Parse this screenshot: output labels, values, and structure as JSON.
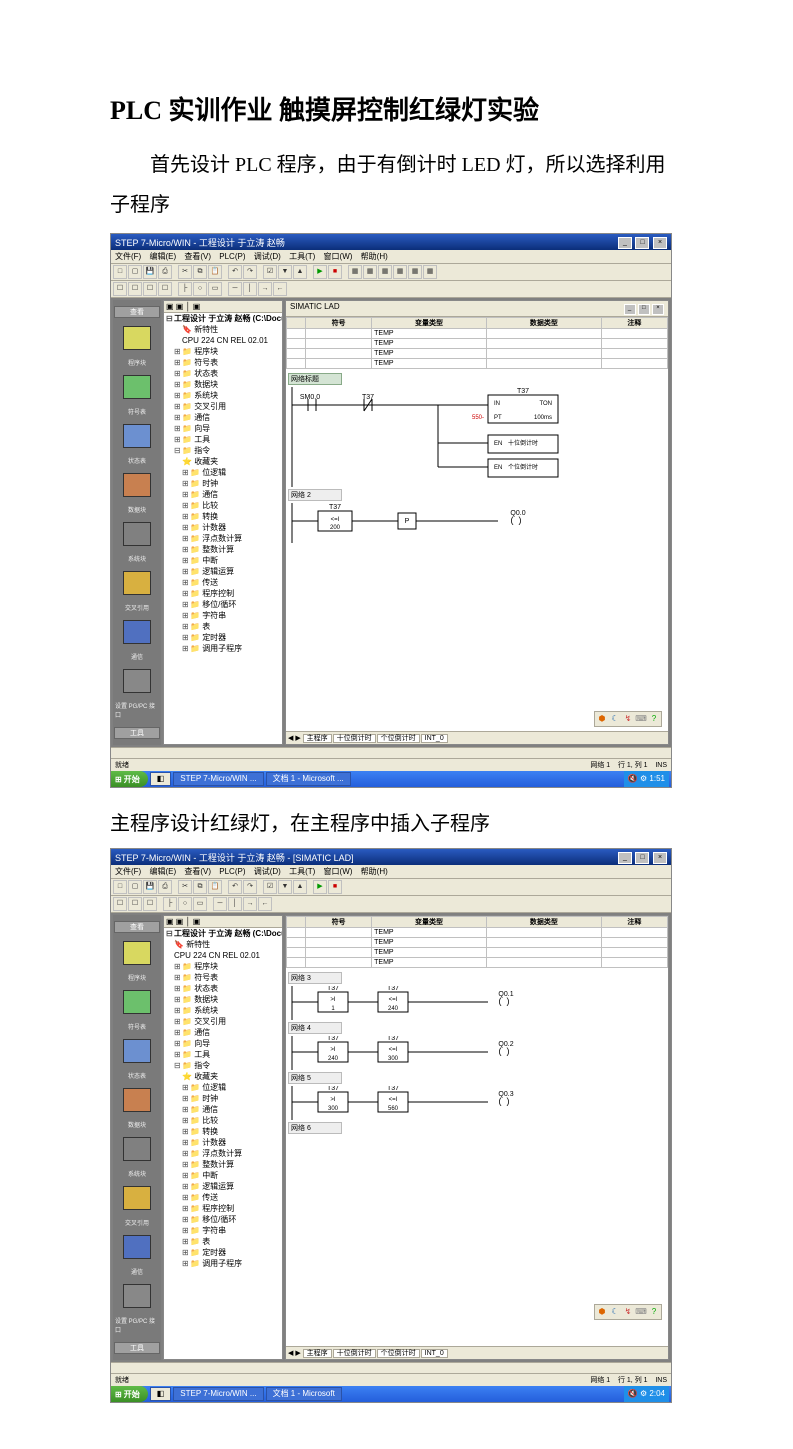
{
  "doc": {
    "title": "PLC 实训作业  触摸屏控制红绿灯实验",
    "para1": "首先设计 PLC 程序，由于有倒计时 LED 灯，所以选择利用子程序",
    "para2": "主程序设计红绿灯，在主程序中插入子程序"
  },
  "app": {
    "title1": "STEP 7-Micro/WIN - 工程设计 于立涛 赵畅",
    "title2": "STEP 7-Micro/WIN - 工程设计 于立涛 赵畅 - [SIMATIC LAD]",
    "menus": [
      "文件(F)",
      "编辑(E)",
      "查看(V)",
      "PLC(P)",
      "调试(D)",
      "工具(T)",
      "窗口(W)",
      "帮助(H)"
    ],
    "nav_header": "查看",
    "nav_tools": "工具",
    "nav_items": [
      "程序块",
      "符号表",
      "状态表",
      "数据块",
      "系统块",
      "交叉引用",
      "通信",
      "设置 PG/PC 接口"
    ],
    "tree": {
      "root": "工程设计 于立涛 赵畅 (C:\\Docum",
      "new_feature": "新特性",
      "cpu": "CPU 224 CN REL 02.01",
      "items": [
        "程序块",
        "符号表",
        "状态表",
        "数据块",
        "系统块",
        "交叉引用",
        "通信",
        "向导",
        "工具",
        "指令",
        "收藏夹",
        "位逻辑",
        "时钟",
        "通信",
        "比较",
        "转换",
        "计数器",
        "浮点数计算",
        "整数计算",
        "中断",
        "逻辑运算",
        "传送",
        "程序控制",
        "移位/循环",
        "字符串",
        "表",
        "定时器",
        "调用子程序"
      ]
    },
    "work": {
      "header": "SIMATIC LAD",
      "cols": [
        "符号",
        "变量类型",
        "数据类型",
        "注释"
      ],
      "vartype": "TEMP",
      "tabs": [
        "主程序",
        "十位倒计时",
        "个位倒计时",
        "INT_0"
      ]
    },
    "ladder1": {
      "net1a_lbl": "网络标题",
      "sm00": "SM0.0",
      "t37": "T37",
      "in": "IN",
      "ton": "TON",
      "pt": "PT",
      "ptv": "550-",
      "ms": "100ms",
      "box1": "十位倒计时",
      "box2": "个位倒计时",
      "en": "EN",
      "net2_lbl": "网络 2",
      "t37b": "T37",
      "val200": "200",
      "i1": "I",
      "p": "P",
      "q00": "Q0.0"
    },
    "ladder2": {
      "net3": "网络 3",
      "net4": "网络 4",
      "net5": "网络 5",
      "net6": "网络 6",
      "t37": "T37",
      "i": ">I",
      "n1": "1",
      "n240": "240",
      "n300": "300",
      "n560": "560",
      "q01": "Q0.1",
      "q02": "Q0.2",
      "q03": "Q0.3"
    },
    "status": {
      "ready": "就绪",
      "net": "网络 1",
      "rc": "行 1, 列 1",
      "ins": "INS"
    },
    "taskbar": {
      "start": "开始",
      "task1": "STEP 7-Micro/WIN ...",
      "task2a": "文档 1 - Microsoft ...",
      "task2b": "文档 1 - Microsoft",
      "time1": "1:51",
      "time2": "2:04"
    }
  }
}
